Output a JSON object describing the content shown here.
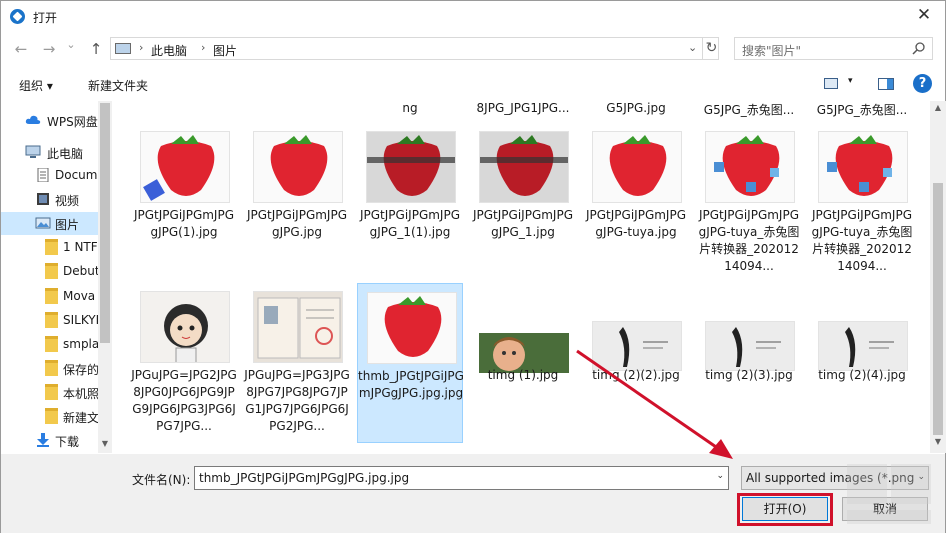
{
  "window": {
    "title": "打开",
    "close_glyph": "✕"
  },
  "nav": {
    "back_glyph": "←",
    "forward_glyph": "→",
    "recent_glyph": "⌄",
    "up_glyph": "↑",
    "path": [
      "此电脑",
      "图片"
    ],
    "sep_glyph": "›",
    "drop_glyph": "⌄",
    "refresh_glyph": "↻",
    "search_placeholder": "搜索\"图片\""
  },
  "toolbar": {
    "organize": "组织 ▾",
    "new_folder": "新建文件夹",
    "view_caret": "▾",
    "help": "?"
  },
  "sidebar": {
    "items": [
      {
        "label": "WPS网盘",
        "icon": "cloud-icon"
      },
      {
        "label": "此电脑",
        "icon": "computer-icon"
      },
      {
        "label": "Docum",
        "icon": "document-icon"
      },
      {
        "label": "视频",
        "icon": "video-icon"
      },
      {
        "label": "图片",
        "icon": "picture-icon",
        "selected": true
      },
      {
        "label": "1 NTF",
        "icon": "folder-icon"
      },
      {
        "label": "Debut",
        "icon": "folder-icon"
      },
      {
        "label": "Mova",
        "icon": "folder-icon"
      },
      {
        "label": "SILKYI",
        "icon": "folder-icon"
      },
      {
        "label": "smpla",
        "icon": "folder-icon"
      },
      {
        "label": "保存的",
        "icon": "folder-icon"
      },
      {
        "label": "本机照",
        "icon": "folder-icon"
      },
      {
        "label": "新建文",
        "icon": "folder-icon"
      },
      {
        "label": "下载",
        "icon": "download-icon"
      }
    ],
    "scroll_down_glyph": "▼"
  },
  "files": {
    "partial_row": [
      "ng",
      "8JPG_JPG1JPG...",
      "G5JPG.jpg",
      "G5JPG_赤兔图...",
      "G5JPG_赤兔图..."
    ],
    "row1": [
      {
        "name": "JPGtJPGiJPGmJPGgJPG(1).jpg",
        "thumb": "strawberry"
      },
      {
        "name": "JPGtJPGiJPGmJPGgJPG.jpg",
        "thumb": "strawberry"
      },
      {
        "name": "JPGtJPGiJPGmJPGgJPG_1(1).jpg",
        "thumb": "strawberry-dark"
      },
      {
        "name": "JPGtJPGiJPGmJPGgJPG_1.jpg",
        "thumb": "strawberry-dark"
      },
      {
        "name": "JPGtJPGiJPGmJPGgJPG-tuya.jpg",
        "thumb": "strawberry"
      },
      {
        "name": "JPGtJPGiJPGmJPGgJPG-tuya_赤兔图片转换器_20201214094...",
        "thumb": "strawberry-doodle"
      },
      {
        "name": "JPGtJPGiJPGmJPGgJPG-tuya_赤兔图片转换器_20201214094...",
        "thumb": "strawberry-doodle"
      }
    ],
    "row2": [
      {
        "name": "JPGuJPG=JPG2JPG8JPG0JPG6JPG9JPG9JPG6JPG3JPG6JPG7JPG...",
        "thumb": "cartoon-girl"
      },
      {
        "name": "JPGuJPG=JPG3JPG8JPG7JPG8JPG7JPG1JPG7JPG6JPG6JPG2JPG...",
        "thumb": "certificate"
      },
      {
        "name": "thmb_JPGtJPGiJPGmJPGgJPG.jpg.jpg",
        "thumb": "strawberry",
        "selected": true
      },
      {
        "name": "timg (1).jpg",
        "thumb": "boy-photo"
      },
      {
        "name": "timg (2)(2).jpg",
        "thumb": "dark-artwork"
      },
      {
        "name": "timg (2)(3).jpg",
        "thumb": "dark-artwork"
      },
      {
        "name": "timg (2)(4).jpg",
        "thumb": "dark-artwork"
      }
    ],
    "scroll_up_glyph": "▲",
    "scroll_down_glyph": "▼"
  },
  "bottom": {
    "filename_label": "文件名(N):",
    "filename_value": "thmb_JPGtJPGiJPGmJPGgJPG.jpg.jpg",
    "drop_glyph": "⌄",
    "filetype_value": "All supported images (*.png",
    "open_label": "打开(O)",
    "cancel_label": "取消"
  },
  "colors": {
    "selection": "#cce8ff",
    "annotation_red": "#d0112b",
    "accent": "#0078d7"
  }
}
